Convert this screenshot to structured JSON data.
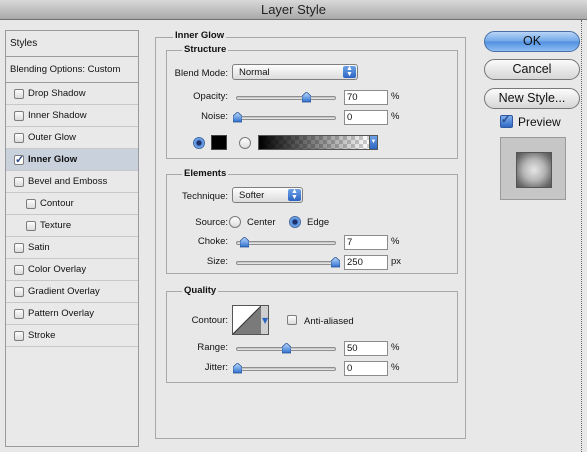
{
  "window": {
    "title": "Layer Style"
  },
  "styles_panel": {
    "header": "Styles",
    "blending": "Blending Options: Custom",
    "items": [
      {
        "label": "Drop Shadow",
        "checked": false
      },
      {
        "label": "Inner Shadow",
        "checked": false
      },
      {
        "label": "Outer Glow",
        "checked": false
      },
      {
        "label": "Inner Glow",
        "checked": true,
        "selected": true
      },
      {
        "label": "Bevel and Emboss",
        "checked": false
      },
      {
        "label": "Contour",
        "checked": false,
        "indent": true
      },
      {
        "label": "Texture",
        "checked": false,
        "indent": true
      },
      {
        "label": "Satin",
        "checked": false
      },
      {
        "label": "Color Overlay",
        "checked": false
      },
      {
        "label": "Gradient Overlay",
        "checked": false
      },
      {
        "label": "Pattern Overlay",
        "checked": false
      },
      {
        "label": "Stroke",
        "checked": false
      }
    ]
  },
  "inner_glow": {
    "title": "Inner Glow",
    "structure": {
      "title": "Structure",
      "blend_mode_label": "Blend Mode:",
      "blend_mode_value": "Normal",
      "opacity_label": "Opacity:",
      "opacity_value": "70",
      "opacity_unit": "%",
      "opacity_level": 0.7,
      "noise_label": "Noise:",
      "noise_value": "0",
      "noise_unit": "%",
      "noise_level": 0.0,
      "color_swatch": "#000000"
    },
    "elements": {
      "title": "Elements",
      "technique_label": "Technique:",
      "technique_value": "Softer",
      "source_label": "Source:",
      "source_center": "Center",
      "source_edge": "Edge",
      "choke_label": "Choke:",
      "choke_value": "7",
      "choke_unit": "%",
      "choke_level": 0.07,
      "size_label": "Size:",
      "size_value": "250",
      "size_unit": "px",
      "size_level": 1.0
    },
    "quality": {
      "title": "Quality",
      "contour_label": "Contour:",
      "antialiased_label": "Anti-aliased",
      "range_label": "Range:",
      "range_value": "50",
      "range_unit": "%",
      "range_level": 0.5,
      "jitter_label": "Jitter:",
      "jitter_value": "0",
      "jitter_unit": "%",
      "jitter_level": 0.0
    }
  },
  "buttons": {
    "ok": "OK",
    "cancel": "Cancel",
    "new_style": "New Style...",
    "preview_label": "Preview",
    "preview_checked": true
  },
  "colors": {
    "accent": "#4f8fe0",
    "selection": "#c9d1dd"
  }
}
